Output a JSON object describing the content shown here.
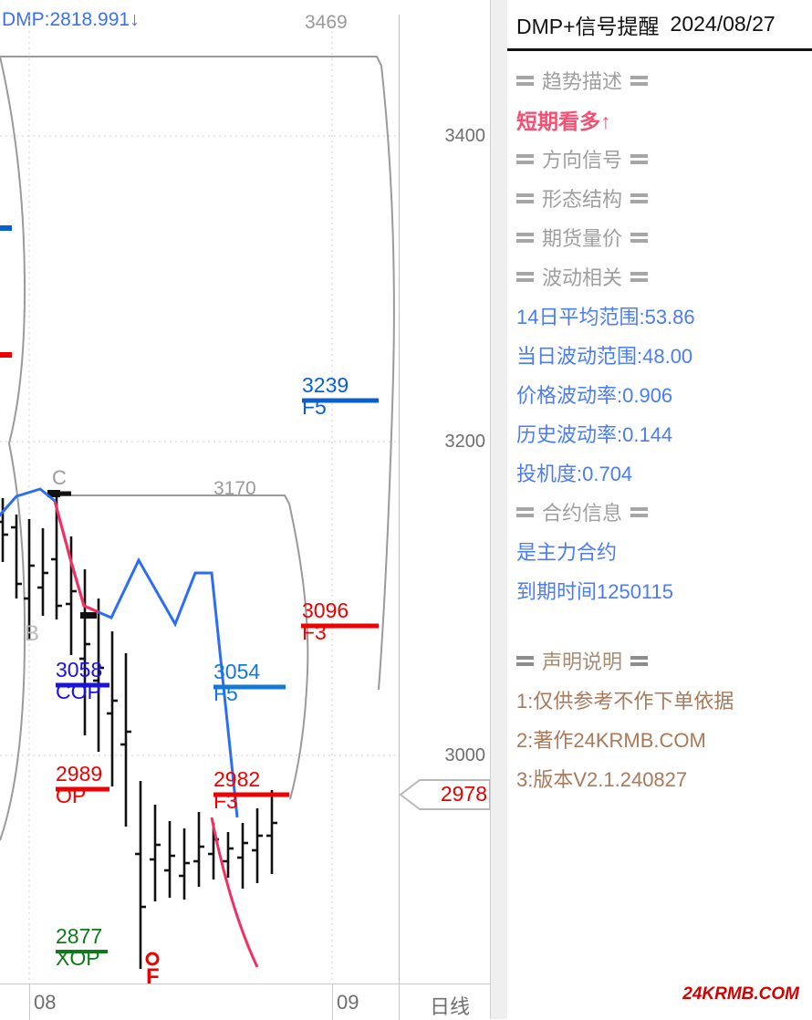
{
  "panel": {
    "header": {
      "title": "DMP+信号提醒",
      "date": "2024/08/27"
    },
    "sections": [
      {
        "type": "section",
        "label": "趋势描述"
      },
      {
        "type": "bull",
        "label": "短期看多↑"
      },
      {
        "type": "section",
        "label": "方向信号"
      },
      {
        "type": "section",
        "label": "形态结构"
      },
      {
        "type": "section",
        "label": "期货量价"
      },
      {
        "type": "section",
        "label": "波动相关"
      },
      {
        "type": "value",
        "label": "14日平均范围:53.86"
      },
      {
        "type": "value",
        "label": "当日波动范围:48.00"
      },
      {
        "type": "value",
        "label": "价格波动率:0.906"
      },
      {
        "type": "value",
        "label": "历史波动率:0.144"
      },
      {
        "type": "value",
        "label": "投机度:0.704"
      },
      {
        "type": "section",
        "label": "合约信息"
      },
      {
        "type": "value",
        "label": "是主力合约"
      },
      {
        "type": "value",
        "label": "到期时间1250115"
      },
      {
        "type": "spacer",
        "label": ""
      },
      {
        "type": "brown",
        "label": "声明说明"
      },
      {
        "type": "disc",
        "label": "1:仅供参考不作下单依据"
      },
      {
        "type": "disc",
        "label": "2:著作24KRMB.COM"
      },
      {
        "type": "disc",
        "label": "3:版本V2.1.240827"
      }
    ],
    "watermark": "24KRMB.COM"
  },
  "chart_data": {
    "type": "line",
    "title": "",
    "xlabel": "",
    "ylabel": "",
    "period_label": "日线",
    "ylim": [
      2840,
      3500
    ],
    "grid": true,
    "dmp_readout": "DMP:2818.991↓",
    "current_price": "2978",
    "price_ticks": [
      {
        "label": "3400",
        "value": 3400
      },
      {
        "label": "3200",
        "value": 3200
      },
      {
        "label": "3000",
        "value": 3000
      }
    ],
    "time_ticks": [
      {
        "label": "08",
        "value": "08"
      },
      {
        "label": "09",
        "value": "09"
      }
    ],
    "levels": [
      {
        "value": "3469",
        "tag": "",
        "color": "#9a9a9a",
        "kind": "envelope-top"
      },
      {
        "value": "3239",
        "tag": "F5",
        "color": "#0a5fd0",
        "kind": "resistance"
      },
      {
        "value": "3170",
        "tag": "",
        "color": "#9a9a9a",
        "kind": "envelope-mid"
      },
      {
        "value": "3096",
        "tag": "F3",
        "color": "#f00000",
        "kind": "resistance"
      },
      {
        "value": "3058",
        "tag": "COP",
        "color": "#1a12e0",
        "kind": "target"
      },
      {
        "value": "3054",
        "tag": "F5",
        "color": "#1478d8",
        "kind": "resistance"
      },
      {
        "value": "2989",
        "tag": "OP",
        "color": "#f00000",
        "kind": "target"
      },
      {
        "value": "2982",
        "tag": "F3",
        "color": "#f00000",
        "kind": "support"
      },
      {
        "value": "2877",
        "tag": "XOP",
        "color": "#0f7a18",
        "kind": "target"
      }
    ],
    "pivots": [
      {
        "label": "B",
        "color": "#b8b8b8"
      },
      {
        "label": "C",
        "color": "#9c9c9c"
      }
    ],
    "markers": [
      {
        "label": "F",
        "color": "#ee0000",
        "shape": "circle-F"
      }
    ],
    "series": [
      {
        "name": "ohlc-bars",
        "color": "#111111"
      },
      {
        "name": "trend-up",
        "color": "#2d6df6"
      },
      {
        "name": "trend-down",
        "color": "#f03060"
      },
      {
        "name": "envelope",
        "color": "#9a9a9a"
      }
    ]
  }
}
